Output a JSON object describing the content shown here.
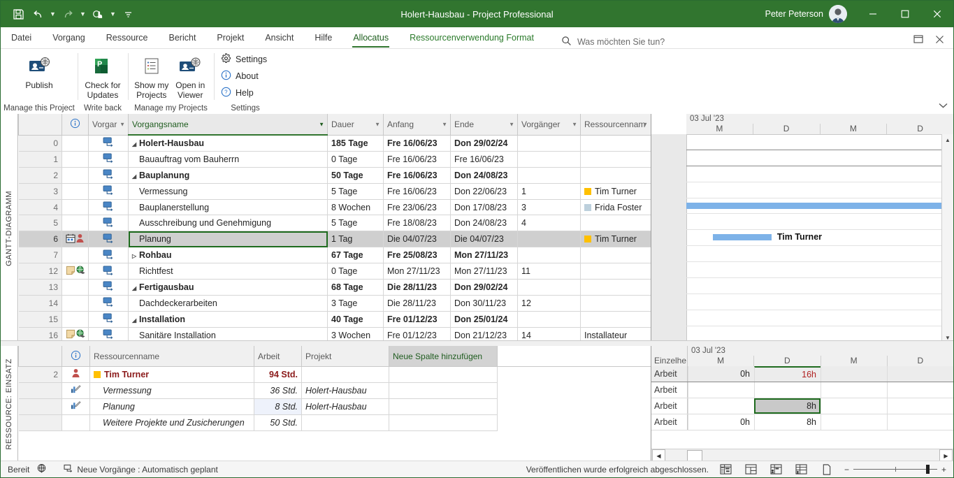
{
  "window": {
    "title": "Holert-Hausbau  -  Project Professional",
    "user": "Peter Peterson",
    "minimize": "−",
    "maximize": "▭",
    "close": "✕"
  },
  "quick_access": {
    "save": "save-icon",
    "undo": "undo-icon",
    "redo": "redo-icon",
    "touch": "touch-mode-icon",
    "more": "more-icon"
  },
  "tabs": [
    {
      "label": "Datei",
      "type": "file"
    },
    {
      "label": "Vorgang",
      "type": "normal"
    },
    {
      "label": "Ressource",
      "type": "normal"
    },
    {
      "label": "Bericht",
      "type": "normal"
    },
    {
      "label": "Projekt",
      "type": "normal"
    },
    {
      "label": "Ansicht",
      "type": "normal"
    },
    {
      "label": "Hilfe",
      "type": "normal"
    },
    {
      "label": "Allocatus",
      "type": "active"
    },
    {
      "label": "Ressourcenverwendung Format",
      "type": "contextual"
    }
  ],
  "search": {
    "placeholder": "Was möchten Sie tun?",
    "icon": "search-icon"
  },
  "ribbon": {
    "groups": [
      {
        "label": "Manage this Project",
        "buttons": [
          {
            "label": "Publish",
            "icon": "publish-icon"
          }
        ]
      },
      {
        "label": "Write back",
        "buttons": [
          {
            "label": "Check for Updates",
            "icon": "project-app-icon"
          }
        ]
      },
      {
        "label": "Manage my Projects",
        "buttons": [
          {
            "label": "Show my Projects",
            "icon": "list-icon"
          },
          {
            "label": "Open in Viewer",
            "icon": "viewer-icon"
          }
        ]
      },
      {
        "label": "Settings",
        "small_buttons": [
          {
            "label": "Settings",
            "icon": "gear-icon"
          },
          {
            "label": "About",
            "icon": "info-icon"
          },
          {
            "label": "Help",
            "icon": "help-icon"
          }
        ]
      }
    ]
  },
  "gantt_view": {
    "side_label": "GANTT-DIAGRAMM",
    "columns": [
      {
        "key": "info",
        "label": "i"
      },
      {
        "key": "mode",
        "label": "Vorgar"
      },
      {
        "key": "name",
        "label": "Vorgangsname"
      },
      {
        "key": "duration",
        "label": "Dauer"
      },
      {
        "key": "start",
        "label": "Anfang"
      },
      {
        "key": "finish",
        "label": "Ende"
      },
      {
        "key": "predecessor",
        "label": "Vorgänger"
      },
      {
        "key": "resources",
        "label": "Ressourcennam"
      }
    ],
    "rows": [
      {
        "id": "0",
        "name": "Holert-Hausbau",
        "indent": 0,
        "expander": "collapse",
        "bold": true,
        "duration": "185 Tage",
        "start": "Fre 16/06/23",
        "finish": "Don 29/02/24",
        "pred": "",
        "res": "",
        "res_color": ""
      },
      {
        "id": "1",
        "name": "Bauauftrag vom Bauherrn",
        "indent": 1,
        "expander": "",
        "bold": false,
        "duration": "0 Tage",
        "start": "Fre 16/06/23",
        "finish": "Fre 16/06/23",
        "pred": "",
        "res": "",
        "res_color": ""
      },
      {
        "id": "2",
        "name": "Bauplanung",
        "indent": 1,
        "expander": "collapse",
        "bold": true,
        "duration": "50 Tage",
        "start": "Fre 16/06/23",
        "finish": "Don 24/08/23",
        "pred": "",
        "res": "",
        "res_color": ""
      },
      {
        "id": "3",
        "name": "Vermessung",
        "indent": 2,
        "expander": "",
        "bold": false,
        "duration": "5 Tage",
        "start": "Fre 16/06/23",
        "finish": "Don 22/06/23",
        "pred": "1",
        "res": "Tim Turner",
        "res_color": "#ffc000"
      },
      {
        "id": "4",
        "name": "Bauplanerstellung",
        "indent": 2,
        "expander": "",
        "bold": false,
        "duration": "8 Wochen",
        "start": "Fre 23/06/23",
        "finish": "Don 17/08/23",
        "pred": "3",
        "res": "Frida Foster",
        "res_color": "#bdd0dc"
      },
      {
        "id": "5",
        "name": "Ausschreibung und Genehmigung",
        "indent": 2,
        "expander": "",
        "bold": false,
        "duration": "5 Tage",
        "start": "Fre 18/08/23",
        "finish": "Don 24/08/23",
        "pred": "4",
        "res": "",
        "res_color": ""
      },
      {
        "id": "6",
        "name": "Planung",
        "indent": 2,
        "expander": "",
        "bold": false,
        "selected": true,
        "indicators": [
          "calendar-icon",
          "person-icon"
        ],
        "duration": "1 Tag",
        "start": "Die 04/07/23",
        "finish": "Die 04/07/23",
        "pred": "",
        "res": "Tim Turner",
        "res_color": "#ffc000"
      },
      {
        "id": "7",
        "name": "Rohbau",
        "indent": 1,
        "expander": "expand",
        "bold": true,
        "duration": "67 Tage",
        "start": "Fre 25/08/23",
        "finish": "Mon 27/11/23",
        "pred": "",
        "res": "",
        "res_color": ""
      },
      {
        "id": "12",
        "name": "Richtfest",
        "indent": 1,
        "expander": "",
        "bold": false,
        "indicators": [
          "note-icon",
          "hyperlink-icon"
        ],
        "duration": "0 Tage",
        "start": "Mon 27/11/23",
        "finish": "Mon 27/11/23",
        "pred": "11",
        "res": "",
        "res_color": ""
      },
      {
        "id": "13",
        "name": "Fertigausbau",
        "indent": 1,
        "expander": "collapse",
        "bold": true,
        "duration": "68 Tage",
        "start": "Die 28/11/23",
        "finish": "Don 29/02/24",
        "pred": "",
        "res": "",
        "res_color": ""
      },
      {
        "id": "14",
        "name": "Dachdeckerarbeiten",
        "indent": 2,
        "expander": "",
        "bold": false,
        "duration": "3 Tage",
        "start": "Die 28/11/23",
        "finish": "Don 30/11/23",
        "pred": "12",
        "res": "",
        "res_color": ""
      },
      {
        "id": "15",
        "name": "Installation",
        "indent": 2,
        "expander": "collapse",
        "bold": true,
        "duration": "40 Tage",
        "start": "Fre 01/12/23",
        "finish": "Don 25/01/24",
        "pred": "",
        "res": "",
        "res_color": ""
      },
      {
        "id": "16",
        "name": "Sanitäre Installation",
        "indent": 3,
        "expander": "",
        "bold": false,
        "indicators": [
          "note-icon",
          "hyperlink-icon"
        ],
        "duration": "3 Wochen",
        "start": "Fre 01/12/23",
        "finish": "Don 21/12/23",
        "pred": "14",
        "res": "Installateur",
        "res_color": ""
      }
    ],
    "timescale": {
      "major": "03 Jul '23",
      "minor": [
        "M",
        "D",
        "M",
        "D"
      ]
    },
    "bars": [
      {
        "row": 4,
        "left_pct": 0,
        "width_pct": 100,
        "label": "",
        "color": "#7db2e8"
      },
      {
        "row": 6,
        "left_pct": 10,
        "width_pct": 22,
        "label": "Tim Turner",
        "color": "#7db2e8"
      }
    ]
  },
  "usage_view": {
    "side_label": "RESSOURCE: EINSATZ",
    "columns": [
      {
        "key": "info",
        "label": "i"
      },
      {
        "key": "name",
        "label": "Ressourcenname"
      },
      {
        "key": "work",
        "label": "Arbeit"
      },
      {
        "key": "project",
        "label": "Projekt"
      },
      {
        "key": "add",
        "label": "Neue Spalte hinzufügen"
      }
    ],
    "rows": [
      {
        "id": "2",
        "name": "Tim Turner",
        "swatch": "#ffc000",
        "work": "94 Std.",
        "project": "",
        "style": "resource",
        "icon": "person-icon"
      },
      {
        "id": "",
        "name": "Vermessung",
        "work": "36 Std.",
        "project": "Holert-Hausbau",
        "style": "assignment",
        "icon": "assignment-icon"
      },
      {
        "id": "",
        "name": "Planung",
        "work": "8 Std.",
        "project": "Holert-Hausbau",
        "style": "assignment",
        "icon": "assignment-icon",
        "work_selected": true
      },
      {
        "id": "",
        "name": "Weitere Projekte und Zusicherungen",
        "work": "50 Std.",
        "project": "",
        "style": "assignment",
        "icon": ""
      }
    ],
    "timescale": {
      "details_label": "Einzelhe",
      "major": "03 Jul '23",
      "minor": [
        "M",
        "D",
        "M",
        "D"
      ]
    },
    "detail_rows": [
      {
        "label": "Arbeit",
        "values": [
          "0h",
          "16h",
          "",
          ""
        ],
        "header": true,
        "red_index": 1
      },
      {
        "label": "Arbeit",
        "values": [
          "",
          "",
          "",
          ""
        ],
        "header": false
      },
      {
        "label": "Arbeit",
        "values": [
          "",
          "8h",
          "",
          ""
        ],
        "header": false,
        "selected_index": 1
      },
      {
        "label": "Arbeit",
        "values": [
          "0h",
          "8h",
          "",
          ""
        ],
        "header": false
      }
    ]
  },
  "status_bar": {
    "state": "Bereit",
    "globe_icon": "globe-icon",
    "schedule_mode": "Neue Vorgänge : Automatisch geplant",
    "message": "Veröffentlichen wurde erfolgreich abgeschlossen.",
    "view_buttons": [
      "gantt-view-icon",
      "task-usage-view-icon",
      "team-planner-icon",
      "resource-sheet-icon",
      "reports-icon"
    ],
    "zoom_out": "−",
    "zoom_in": "+"
  },
  "colors": {
    "brand_green": "#31752f",
    "accent_bar": "#7db2e8",
    "resource_yellow": "#ffc000",
    "alert_red": "#b02020"
  }
}
